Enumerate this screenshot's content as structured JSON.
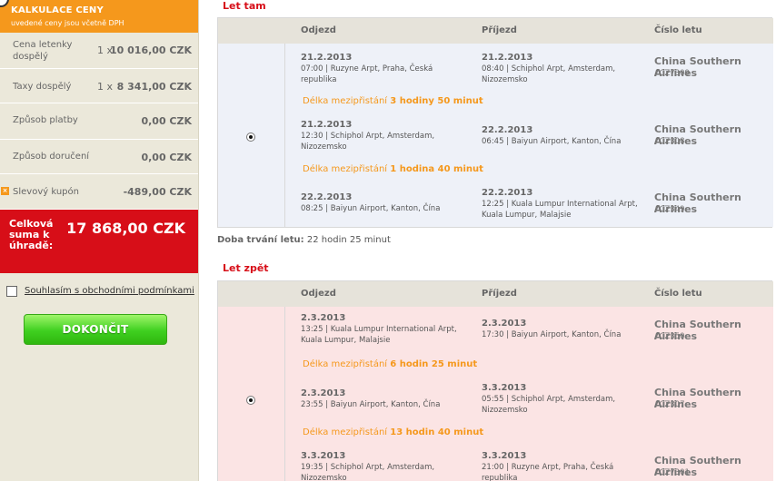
{
  "sidebar": {
    "title": "KALKULACE CENY",
    "subtitle": "uvedené ceny jsou včetně DPH",
    "rows": [
      {
        "label": "Cena letenky dospělý",
        "qty": "1 x",
        "value": "10 016,00 CZK"
      },
      {
        "label": "Taxy dospělý",
        "qty": "1 x",
        "value": "8 341,00 CZK"
      },
      {
        "label": "Způsob platby",
        "qty": "",
        "value": "0,00 CZK"
      },
      {
        "label": "Způsob doručení",
        "qty": "",
        "value": "0,00 CZK"
      },
      {
        "label": "Slevový kupón",
        "qty": "",
        "value": "-489,00 CZK"
      }
    ],
    "total_label": "Celková suma k úhradě:",
    "total_value": "17 868,00 CZK",
    "agree_label": "Souhlasím s obchodními podmínkami",
    "finish_label": "DOKONČIT"
  },
  "colors": {
    "accent": "#f5981c",
    "total_bg": "#d70e18",
    "button_green": "#3fd020"
  },
  "headers": {
    "depart": "Odjezd",
    "arrive": "Příjezd",
    "flight": "Číslo letu"
  },
  "outbound": {
    "title": "Let tam",
    "segments": [
      {
        "dep_date": "21.2.2013",
        "dep_time_place": "07:00 | Ruzyne Arpt, Praha, Česká republika",
        "arr_date": "21.2.2013",
        "arr_time_place": "08:40 | Schiphol Arpt, Amsterdam, Nizozemsko",
        "airline": "China Southern Airlines",
        "flight": "/ CZ7309"
      },
      {
        "dep_date": "21.2.2013",
        "dep_time_place": "12:30 | Schiphol Arpt, Amsterdam, Nizozemsko",
        "arr_date": "22.2.2013",
        "arr_time_place": "06:45 | Baiyun Airport, Kanton, Čína",
        "airline": "China Southern Airlines",
        "flight": "/ CZ308"
      },
      {
        "dep_date": "22.2.2013",
        "dep_time_place": "08:25 | Baiyun Airport, Kanton, Čína",
        "arr_date": "22.2.2013",
        "arr_time_place": "12:25 | Kuala Lumpur International Arpt, Kuala Lumpur, Malajsie",
        "airline": "China Southern Airlines",
        "flight": "/ CZ349"
      }
    ],
    "layovers": [
      {
        "prefix": "Délka mezipřistání ",
        "value": "3 hodiny 50 minut"
      },
      {
        "prefix": "Délka mezipřistání ",
        "value": "1 hodina 40 minut"
      }
    ],
    "duration_label": "Doba trvání letu:",
    "duration_value": " 22 hodin 25 minut"
  },
  "return": {
    "title": "Let zpět",
    "segments": [
      {
        "dep_date": "2.3.2013",
        "dep_time_place": "13:25 | Kuala Lumpur International Arpt, Kuala Lumpur, Malajsie",
        "arr_date": "2.3.2013",
        "arr_time_place": "17:30 | Baiyun Airport, Kanton, Čína",
        "airline": "China Southern Airlines",
        "flight": "/ CZ350"
      },
      {
        "dep_date": "2.3.2013",
        "dep_time_place": "23:55 | Baiyun Airport, Kanton, Čína",
        "arr_date": "3.3.2013",
        "arr_time_place": "05:55 | Schiphol Arpt, Amsterdam, Nizozemsko",
        "airline": "China Southern Airlines",
        "flight": "/ CZ307"
      },
      {
        "dep_date": "3.3.2013",
        "dep_time_place": "19:35 | Schiphol Arpt, Amsterdam, Nizozemsko",
        "arr_date": "3.3.2013",
        "arr_time_place": "21:00 | Ruzyne Arpt, Praha, Česká republika",
        "airline": "China Southern Airlines",
        "flight": "/ CZ7301"
      }
    ],
    "layovers": [
      {
        "prefix": "Délka mezipřistání ",
        "value": "6 hodin 25 minut"
      },
      {
        "prefix": "Délka mezipřistání ",
        "value": "13 hodin 40 minut"
      }
    ]
  }
}
